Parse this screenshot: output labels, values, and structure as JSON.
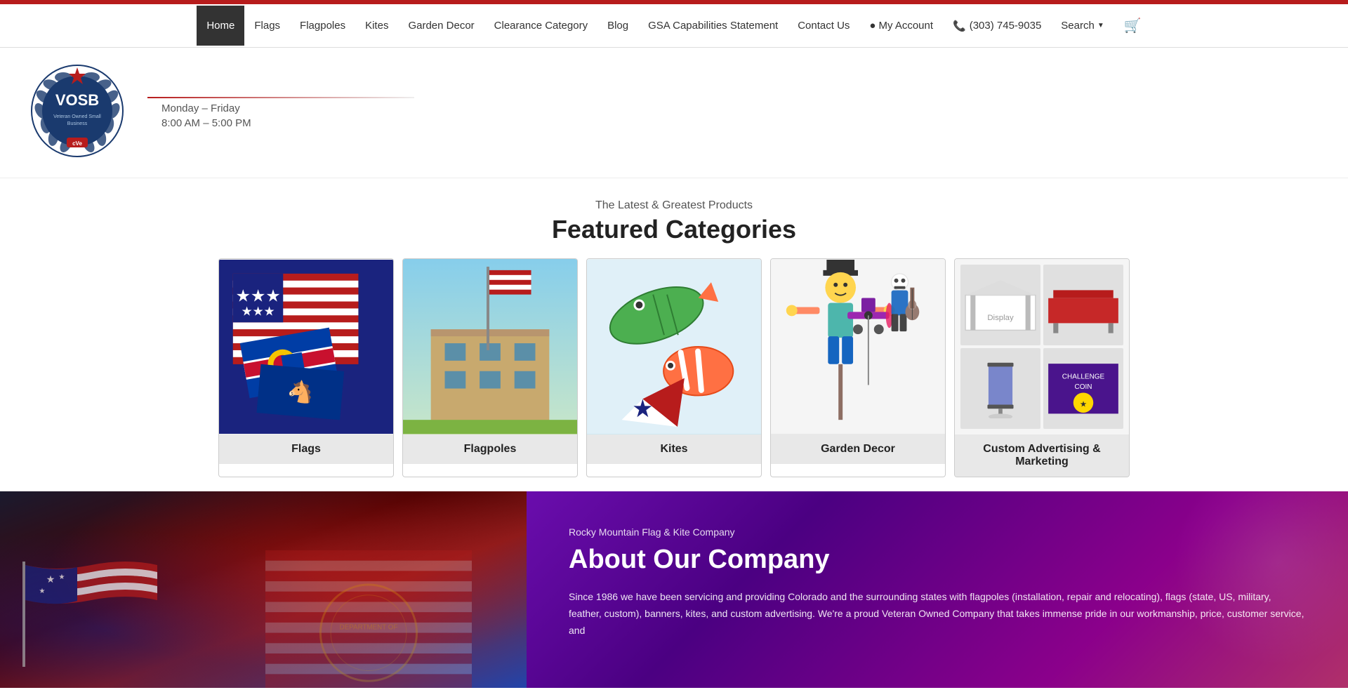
{
  "topbar": {
    "color": "#b71c1c"
  },
  "nav": {
    "items": [
      {
        "id": "home",
        "label": "Home",
        "active": true
      },
      {
        "id": "flags",
        "label": "Flags",
        "active": false
      },
      {
        "id": "flagpoles",
        "label": "Flagpoles",
        "active": false
      },
      {
        "id": "kites",
        "label": "Kites",
        "active": false
      },
      {
        "id": "garden-decor",
        "label": "Garden Decor",
        "active": false
      },
      {
        "id": "clearance-category",
        "label": "Clearance Category",
        "active": false
      },
      {
        "id": "blog",
        "label": "Blog",
        "active": false
      },
      {
        "id": "gsa-capabilities",
        "label": "GSA Capabilities Statement",
        "active": false
      },
      {
        "id": "contact-us",
        "label": "Contact Us",
        "active": false
      },
      {
        "id": "my-account",
        "label": "My Account",
        "active": false
      },
      {
        "id": "phone",
        "label": "(303) 745-9035",
        "active": false
      },
      {
        "id": "search",
        "label": "Search",
        "active": false
      }
    ]
  },
  "logo": {
    "alt": "VOSB - Veteran Owned Small Business CVE Logo"
  },
  "business_hours": {
    "days": "Monday – Friday",
    "hours": "8:00 AM – 5:00 PM"
  },
  "featured": {
    "subtitle": "The Latest & Greatest Products",
    "title": "Featured Categories",
    "categories": [
      {
        "id": "flags",
        "label": "Flags"
      },
      {
        "id": "flagpoles",
        "label": "Flagpoles"
      },
      {
        "id": "kites",
        "label": "Kites"
      },
      {
        "id": "garden-decor",
        "label": "Garden Decor"
      },
      {
        "id": "custom-advertising",
        "label": "Custom Advertising & Marketing"
      }
    ]
  },
  "about": {
    "company_name": "Rocky Mountain Flag & Kite Company",
    "title": "About Our Company",
    "body": "Since 1986 we have been servicing and providing Colorado and the surrounding states with flagpoles (installation, repair and relocating), flags (state, US, military, feather, custom), banners, kites, and custom advertising. We're a proud Veteran Owned Company that takes immense pride in our workmanship, price, customer service, and"
  }
}
